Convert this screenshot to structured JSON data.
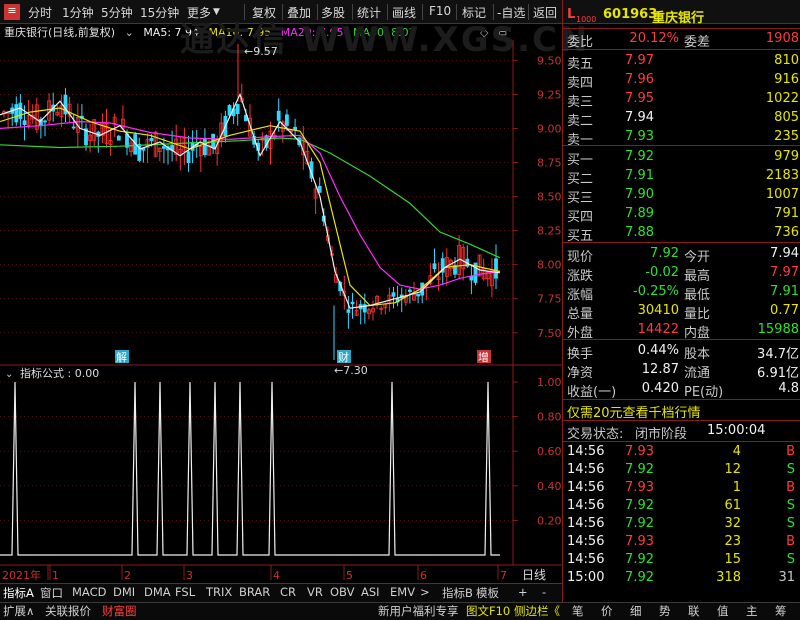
{
  "toolbar": {
    "left_items": [
      "分时",
      "1分钟",
      "5分钟",
      "15分钟",
      "更多"
    ],
    "right_items": [
      "复权",
      "叠加",
      "多股",
      "统计",
      "画线",
      "F10",
      "标记",
      "-自选",
      "返回"
    ]
  },
  "chart_header": {
    "stock": "重庆银行(日线,前复权)",
    "ma5": "MA5: 7.94",
    "ma10": "MA10: 7.95",
    "ma20": "MA20: 7.95",
    "ma60": "MA60: 8.03"
  },
  "watermark": "通达信 WWW.XGS.CN",
  "colors": {
    "ma5": "#f0f0f0",
    "ma10": "#e6e600",
    "ma20": "#ff2cff",
    "ma60": "#33d633",
    "up": "#ff3030",
    "down": "#30d8ff",
    "grid": "#8a1a1a"
  },
  "chart_data": {
    "type": "line",
    "price_axis": [
      "9.50",
      "9.25",
      "9.00",
      "8.75",
      "8.50",
      "8.25",
      "8.00",
      "7.75",
      "7.50"
    ],
    "high_label": "9.57",
    "low_label": "7.30",
    "event_markers": [
      "解",
      "财",
      "增"
    ],
    "indicator_title": "指标公式 : 0.00",
    "indicator_axis": [
      "1.00",
      "0.80",
      "0.60",
      "0.40",
      "0.20"
    ],
    "x_labels": [
      "2021年",
      "1",
      "2",
      "3",
      "4",
      "5",
      "6",
      "7"
    ],
    "ma60": [
      [
        0,
        8.88
      ],
      [
        60,
        8.86
      ],
      [
        120,
        8.87
      ],
      [
        180,
        8.89
      ],
      [
        240,
        8.91
      ],
      [
        280,
        8.93
      ],
      [
        300,
        8.92
      ],
      [
        330,
        8.82
      ],
      [
        370,
        8.65
      ],
      [
        410,
        8.45
      ],
      [
        440,
        8.24
      ],
      [
        470,
        8.15
      ],
      [
        500,
        8.05
      ]
    ],
    "ma20": [
      [
        0,
        9.0
      ],
      [
        40,
        9.02
      ],
      [
        80,
        9.05
      ],
      [
        110,
        9.04
      ],
      [
        150,
        8.97
      ],
      [
        190,
        8.93
      ],
      [
        230,
        8.92
      ],
      [
        270,
        8.94
      ],
      [
        300,
        8.95
      ],
      [
        320,
        8.82
      ],
      [
        340,
        8.5
      ],
      [
        360,
        8.22
      ],
      [
        380,
        7.98
      ],
      [
        400,
        7.85
      ],
      [
        420,
        7.82
      ],
      [
        440,
        7.85
      ],
      [
        460,
        7.9
      ],
      [
        480,
        7.93
      ],
      [
        500,
        7.95
      ]
    ],
    "ma10": [
      [
        0,
        9.05
      ],
      [
        30,
        9.12
      ],
      [
        60,
        9.15
      ],
      [
        90,
        9.05
      ],
      [
        120,
        8.98
      ],
      [
        150,
        8.95
      ],
      [
        190,
        8.85
      ],
      [
        230,
        8.95
      ],
      [
        270,
        9.02
      ],
      [
        300,
        8.98
      ],
      [
        320,
        8.75
      ],
      [
        335,
        8.3
      ],
      [
        350,
        7.85
      ],
      [
        370,
        7.7
      ],
      [
        395,
        7.72
      ],
      [
        420,
        7.82
      ],
      [
        445,
        7.98
      ],
      [
        470,
        8.0
      ],
      [
        500,
        7.95
      ]
    ],
    "ma5": [
      [
        0,
        9.1
      ],
      [
        20,
        9.15
      ],
      [
        40,
        9.05
      ],
      [
        60,
        9.2
      ],
      [
        80,
        9.0
      ],
      [
        100,
        8.95
      ],
      [
        120,
        9.02
      ],
      [
        140,
        8.85
      ],
      [
        160,
        8.9
      ],
      [
        180,
        8.8
      ],
      [
        200,
        8.9
      ],
      [
        215,
        8.85
      ],
      [
        240,
        9.25
      ],
      [
        260,
        8.8
      ],
      [
        280,
        9.05
      ],
      [
        300,
        8.9
      ],
      [
        320,
        8.5
      ],
      [
        335,
        7.95
      ],
      [
        350,
        7.68
      ],
      [
        370,
        7.7
      ],
      [
        395,
        7.75
      ],
      [
        420,
        7.8
      ],
      [
        445,
        7.98
      ],
      [
        460,
        8.04
      ],
      [
        480,
        7.96
      ],
      [
        500,
        7.94
      ]
    ],
    "indicator_spikes_x": [
      15,
      135,
      160,
      190,
      215,
      240,
      272,
      392,
      488
    ]
  },
  "quote": {
    "code": "601963",
    "name": "重庆银行",
    "l_badge": "L",
    "l_badge_sub": "1000",
    "webi_label": "委比",
    "webi_value": "20.12%",
    "weicha_label": "委差",
    "weicha_value": "1908",
    "asks": [
      {
        "label": "卖五",
        "price": "7.97",
        "vol": "810"
      },
      {
        "label": "卖四",
        "price": "7.96",
        "vol": "916"
      },
      {
        "label": "卖三",
        "price": "7.95",
        "vol": "1022"
      },
      {
        "label": "卖二",
        "price": "7.94",
        "vol": "805"
      },
      {
        "label": "卖一",
        "price": "7.93",
        "vol": "235"
      }
    ],
    "bids": [
      {
        "label": "买一",
        "price": "7.92",
        "vol": "979"
      },
      {
        "label": "买二",
        "price": "7.91",
        "vol": "2183"
      },
      {
        "label": "买三",
        "price": "7.90",
        "vol": "1007"
      },
      {
        "label": "买四",
        "price": "7.89",
        "vol": "791"
      },
      {
        "label": "买五",
        "price": "7.88",
        "vol": "736"
      }
    ],
    "stats": [
      {
        "l1": "现价",
        "v1": "7.92",
        "l2": "今开",
        "v2": "7.94"
      },
      {
        "l1": "涨跌",
        "v1": "-0.02",
        "l2": "最高",
        "v2": "7.97"
      },
      {
        "l1": "涨幅",
        "v1": "-0.25%",
        "l2": "最低",
        "v2": "7.91"
      },
      {
        "l1": "总量",
        "v1": "30410",
        "l2": "量比",
        "v2": "0.77"
      },
      {
        "l1": "外盘",
        "v1": "14422",
        "l2": "内盘",
        "v2": "15988"
      }
    ],
    "stats2": [
      {
        "l1": "换手",
        "v1": "0.44%",
        "l2": "股本",
        "v2": "34.7亿"
      },
      {
        "l1": "净资",
        "v1": "12.87",
        "l2": "流通",
        "v2": "6.91亿"
      },
      {
        "l1": "收益(一)",
        "v1": "0.420",
        "l2": "PE(动)",
        "v2": "4.8"
      }
    ],
    "promo": "仅需20元查看千档行情",
    "trade_status_label": "交易状态:",
    "trade_status": "闭市阶段",
    "trade_time": "15:00:04",
    "ticks": [
      {
        "t": "14:56",
        "p": "7.93",
        "v": "4",
        "s": "B"
      },
      {
        "t": "14:56",
        "p": "7.92",
        "v": "12",
        "s": "S"
      },
      {
        "t": "14:56",
        "p": "7.93",
        "v": "1",
        "s": "B"
      },
      {
        "t": "14:56",
        "p": "7.92",
        "v": "61",
        "s": "S"
      },
      {
        "t": "14:56",
        "p": "7.92",
        "v": "32",
        "s": "S"
      },
      {
        "t": "14:56",
        "p": "7.93",
        "v": "23",
        "s": "B"
      },
      {
        "t": "14:56",
        "p": "7.92",
        "v": "15",
        "s": "S"
      },
      {
        "t": "15:00",
        "p": "7.92",
        "v": "318",
        "s": "31"
      }
    ]
  },
  "bottom_tabs": [
    "指标A",
    "窗口",
    "MACD",
    "DMI",
    "DMA",
    "FSL",
    "TRIX",
    "BRAR",
    "CR",
    "VR",
    "OBV",
    "ASI",
    "EMV",
    ">",
    "指标B",
    "模板",
    "+",
    "-"
  ],
  "period_label": "日线",
  "bottom2_left": [
    "扩展∧",
    "关联报价",
    "财富圈"
  ],
  "bottom2_mid": [
    "新用户福利专享",
    "图文F10",
    "侧边栏《"
  ],
  "bottom2_right": [
    "笔",
    "价",
    "细",
    "势",
    "联",
    "值",
    "主",
    "筹"
  ]
}
